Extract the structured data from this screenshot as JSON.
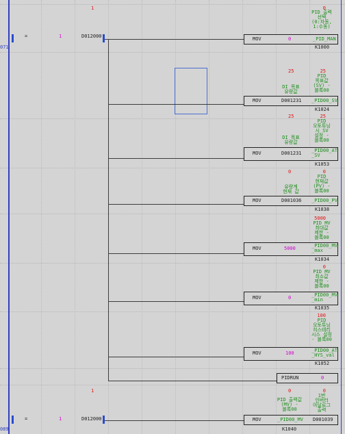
{
  "top": {
    "step_num": "1",
    "out0_value": "0"
  },
  "left_labels": {
    "rung1_line": "071",
    "rung2_line": "089"
  },
  "rung1": {
    "contact_symbol": "=",
    "contact_value": "1",
    "contact_device": "D012000",
    "out0": {
      "cmd": "MOV",
      "src": "0",
      "dst": "_PID_MAN",
      "addr": "K1000",
      "comment": "PID 출력\n선택\n(0:자동,\n1:수동)"
    },
    "out1": {
      "cmd": "MOV",
      "src": "D001231",
      "dst": "_PID00_SV",
      "addr": "K1024",
      "src_val": "25",
      "dst_val": "25",
      "src_comment": "DI 목표\n유량값",
      "dst_comment": "PID\n목표값\n(SV) -\n블록00"
    },
    "out2": {
      "cmd": "MOV",
      "src": "D001231",
      "dst": "_PID00_AT\n_SV",
      "addr": "K1053",
      "src_val": "25",
      "dst_val": "25",
      "src_comment": "DI 목표\n유량값",
      "dst_comment": "PID\n오토튜닝\n시 SV\n설정 -\n블록00"
    },
    "out3": {
      "cmd": "MOV",
      "src": "D001036",
      "dst": "_PID00_PV",
      "addr": "K1038",
      "src_val": "0",
      "dst_val": "0",
      "src_comment": "유량계\n현재 값",
      "dst_comment": "PID\n현재값\n(PV) -\n블록00"
    },
    "out4": {
      "cmd": "MOV",
      "src": "5000",
      "dst": "_PID00_MV\n_max",
      "addr": "K1034",
      "dst_val": "5000",
      "dst_comment": "PID MV\n최대값\n제한 -\n블록00"
    },
    "out5": {
      "cmd": "MOV",
      "src": "0",
      "dst": "_PID00_MV\n_min",
      "addr": "K1035",
      "dst_val": "0",
      "dst_comment": "PID MV\n최소값\n제한 -\n블록00"
    },
    "out6": {
      "cmd": "MOV",
      "src": "100",
      "dst": "_PID00_AT\n_HYS_val",
      "addr": "K1052",
      "dst_val": "100",
      "dst_comment": "PID\n오토튜닝\n히스테리\n시스 설정\n- 블록00"
    },
    "out7": {
      "name": "PIDRUN",
      "value": "0"
    }
  },
  "rung2": {
    "step_num": "1",
    "contact_symbol": "=",
    "contact_value": "1",
    "contact_device": "D012000",
    "out0": {
      "cmd": "MOV",
      "src": "_PID00_MV",
      "dst": "D001039",
      "addr": "K1040",
      "src_val": "0",
      "dst_val": "0",
      "src_comment": "PID 출력값\n(MV) -\n블록00",
      "dst_comment": "1번\n인버터\n아날로그\n출력"
    }
  },
  "colors": {
    "rail": "#3040c0",
    "selection": "#4a6fd0",
    "value_red": "#e01010",
    "comment_green": "#1a8e1a",
    "value_magenta": "#d000d0"
  }
}
